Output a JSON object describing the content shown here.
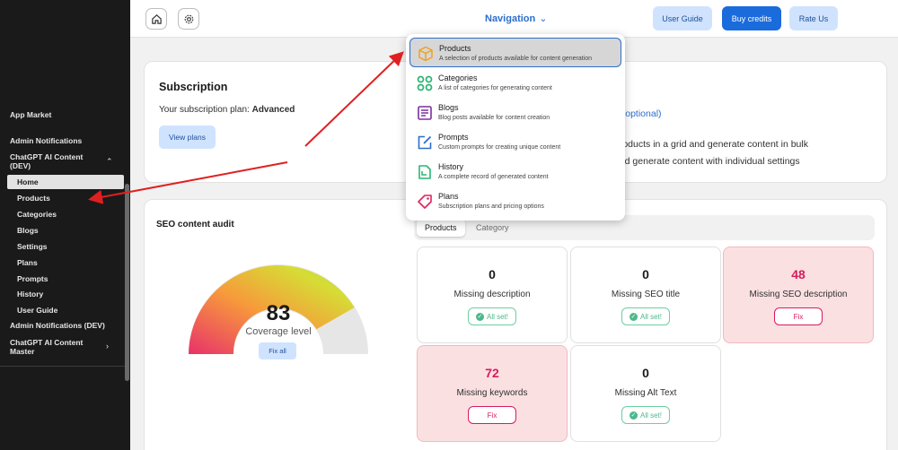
{
  "sidebar": {
    "app_market": "App Market",
    "admin_notifications": "Admin Notifications",
    "chatgpt_ai_content_line1": "ChatGPT AI Content",
    "chatgpt_ai_content_line2": "(DEV)",
    "subitems": [
      "Home",
      "Products",
      "Categories",
      "Blogs",
      "Settings",
      "Plans",
      "Prompts",
      "History",
      "User Guide"
    ],
    "admin_notifications_dev": "Admin Notifications (DEV)",
    "master_line1": "ChatGPT AI Content",
    "master_line2": "Master"
  },
  "topbar": {
    "navigation_label": "Navigation",
    "user_guide": "User Guide",
    "buy_credits": "Buy credits",
    "rate_us": "Rate Us"
  },
  "subscription": {
    "title": "Subscription",
    "plan_prefix": "Your subscription plan: ",
    "plan_name": "Advanced",
    "view_plans": "View plans"
  },
  "behind": {
    "optional": "p (optional)",
    "line1": "products in a grid and generate content in bulk",
    "line2": "and generate content with individual settings"
  },
  "dropdown": [
    {
      "title": "Products",
      "desc": "A selection of products available for content generation",
      "icon": "box-icon"
    },
    {
      "title": "Categories",
      "desc": "A list of categories for generating content",
      "icon": "categories-icon"
    },
    {
      "title": "Blogs",
      "desc": "Blog posts available for content creation",
      "icon": "blog-icon"
    },
    {
      "title": "Prompts",
      "desc": "Custom prompts for creating unique content",
      "icon": "edit-icon"
    },
    {
      "title": "History",
      "desc": "A complete record of generated content",
      "icon": "history-icon"
    },
    {
      "title": "Plans",
      "desc": "Subscription plans and pricing options",
      "icon": "tag-icon"
    }
  ],
  "seo": {
    "title": "SEO content audit",
    "coverage_value": "83",
    "coverage_label": "Coverage level",
    "fix_all": "Fix all",
    "tabs": [
      "Products",
      "Category"
    ],
    "metrics": [
      {
        "value": "0",
        "label": "Missing description",
        "action": "All set!"
      },
      {
        "value": "0",
        "label": "Missing SEO title",
        "action": "All set!"
      },
      {
        "value": "48",
        "label": "Missing SEO description",
        "action": "Fix"
      },
      {
        "value": "72",
        "label": "Missing keywords",
        "action": "Fix"
      },
      {
        "value": "0",
        "label": "Missing Alt Text",
        "action": "All set!"
      }
    ]
  },
  "colors": {
    "accent": "#2c6ecb",
    "warn": "#d81b60",
    "ok": "#4bb98a",
    "arrow": "#e02020"
  }
}
